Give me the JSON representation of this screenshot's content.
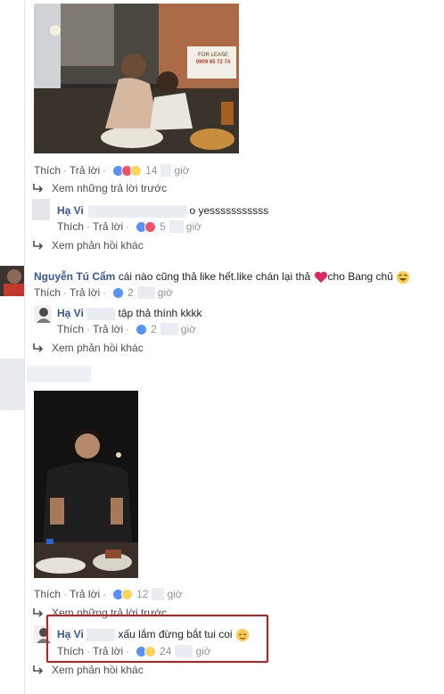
{
  "actions": {
    "like": "Thích",
    "reply": "Trả lời",
    "sep": "·",
    "time_unit": "giờ"
  },
  "thread1": {
    "reaction_count": "14",
    "view_previous": "Xem những trả lời trước",
    "reply": {
      "author": "Hạ Vi",
      "text": "o yesssssssssss",
      "reaction_count": "5"
    },
    "view_more": "Xem phản hồi khác"
  },
  "comment2": {
    "author": "Nguyễn Tú Cẩm",
    "text": "cái nào cũng thả like hết.like chán lại thả",
    "text_after": "cho Bang chủ",
    "reaction_count": "2",
    "reply": {
      "author": "Hạ Vi",
      "text": "tập thả thính kkkk",
      "reaction_count": "2"
    },
    "view_more": "Xem phản hồi khác"
  },
  "thread3": {
    "reaction_count": "12",
    "view_previous": "Xem những trả lời trước",
    "reply": {
      "author": "Hạ Vi",
      "text": "xấu lắm đừng bắt tui coi",
      "reaction_count": "24"
    },
    "view_more": "Xem phản hồi khác"
  },
  "photo1_sign": {
    "line1": "FOR LEASE",
    "line2": "0909 65 72 74"
  },
  "colors": {
    "link": "#365899",
    "meta": "#90949c",
    "highlight": "#d0191a",
    "like": "#5890ff",
    "love": "#f25268",
    "haha": "#ffd45b"
  }
}
